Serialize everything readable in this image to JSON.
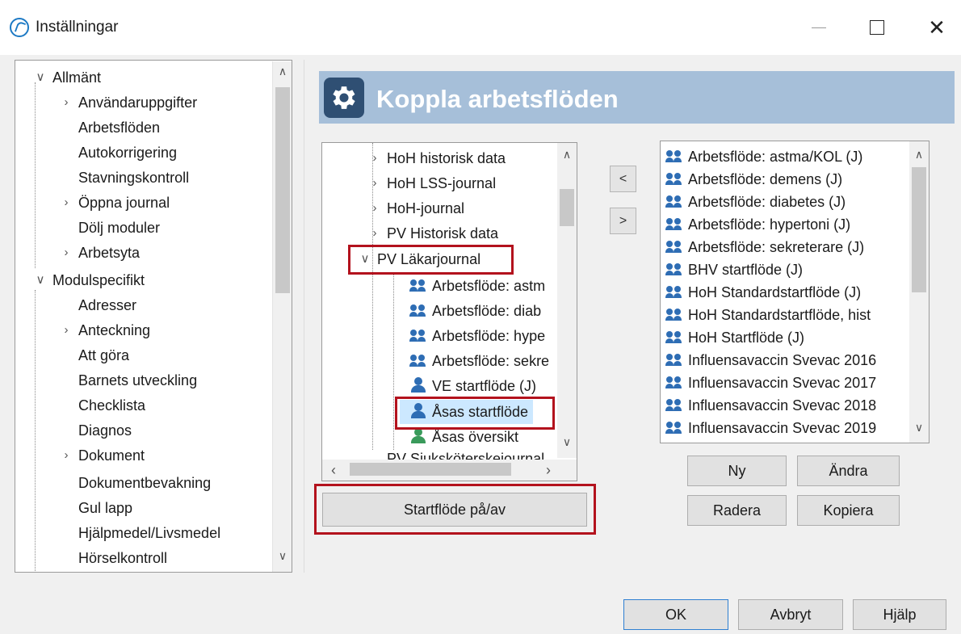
{
  "window": {
    "title": "Inställningar",
    "minimize_icon": "minimize-icon",
    "maximize_icon": "maximize-icon",
    "close_icon": "close-icon"
  },
  "left_tree": {
    "items": [
      {
        "label": "Allmänt",
        "expander": "expanded"
      },
      {
        "label": "Användaruppgifter",
        "expander": "collapsed"
      },
      {
        "label": "Arbetsflöden",
        "expander": "none"
      },
      {
        "label": "Autokorrigering",
        "expander": "none"
      },
      {
        "label": "Stavningskontroll",
        "expander": "none"
      },
      {
        "label": "Öppna journal",
        "expander": "collapsed"
      },
      {
        "label": "Dölj moduler",
        "expander": "none"
      },
      {
        "label": "Arbetsyta",
        "expander": "collapsed"
      },
      {
        "label": "Modulspecifikt",
        "expander": "expanded"
      },
      {
        "label": "Adresser",
        "expander": "none"
      },
      {
        "label": "Anteckning",
        "expander": "collapsed"
      },
      {
        "label": "Att göra",
        "expander": "none"
      },
      {
        "label": "Barnets utveckling",
        "expander": "none"
      },
      {
        "label": "Checklista",
        "expander": "none"
      },
      {
        "label": "Diagnos",
        "expander": "none"
      },
      {
        "label": "Dokument",
        "expander": "collapsed"
      },
      {
        "label": "Dokumentbevakning",
        "expander": "none"
      },
      {
        "label": "Gul lapp",
        "expander": "none"
      },
      {
        "label": "Hjälpmedel/Livsmedel",
        "expander": "none"
      },
      {
        "label": "Hörselkontroll",
        "expander": "none"
      }
    ]
  },
  "header": {
    "title": "Koppla arbetsflöden",
    "icon": "gear-icon",
    "bg_color": "#a6bfd9",
    "icon_bg_color": "#2f4f73"
  },
  "workflow_tree": {
    "items": [
      {
        "label": "HoH historisk data",
        "expander": "collapsed"
      },
      {
        "label": "HoH LSS-journal",
        "expander": "collapsed"
      },
      {
        "label": "HoH-journal",
        "expander": "collapsed"
      },
      {
        "label": "PV Historisk data",
        "expander": "collapsed"
      },
      {
        "label": "PV Läkarjournal",
        "expander": "expanded"
      },
      {
        "label": "Arbetsflöde: astm",
        "icon": "group-icon"
      },
      {
        "label": "Arbetsflöde: diab",
        "icon": "group-icon"
      },
      {
        "label": "Arbetsflöde: hype",
        "icon": "group-icon"
      },
      {
        "label": "Arbetsflöde: sekre",
        "icon": "group-icon"
      },
      {
        "label": "VE startflöde (J)",
        "icon": "user-start-icon"
      },
      {
        "label": "Åsas startflöde",
        "icon": "user-start-icon"
      },
      {
        "label": "Åsas översikt",
        "icon": "user-green-icon"
      },
      {
        "label": "PV Sjuksköterskejournal",
        "expander": "collapsed"
      }
    ],
    "selected": "Åsas startflöde"
  },
  "transfer_buttons": {
    "left_label": "<",
    "right_label": ">"
  },
  "start_toggle_button": "Startflöde på/av",
  "workflow_list": {
    "items": [
      "Arbetsflöde: astma/KOL (J)",
      "Arbetsflöde: demens (J)",
      "Arbetsflöde: diabetes (J)",
      "Arbetsflöde: hypertoni (J)",
      "Arbetsflöde: sekreterare (J)",
      "BHV startflöde (J)",
      "HoH Standardstartflöde (J)",
      "HoH Standardstartflöde, hist",
      "HoH Startflöde (J)",
      "Influensavaccin Svevac 2016",
      "Influensavaccin Svevac 2017",
      "Influensavaccin Svevac 2018",
      "Influensavaccin Svevac 2019"
    ]
  },
  "list_buttons": {
    "new": "Ny",
    "edit": "Ändra",
    "delete": "Radera",
    "copy": "Kopiera"
  },
  "footer": {
    "ok": "OK",
    "cancel": "Avbryt",
    "help": "Hjälp"
  },
  "colors": {
    "highlight_border": "#b3121d",
    "selection_bg": "#cce8ff",
    "group_icon": "#2e6db4"
  }
}
